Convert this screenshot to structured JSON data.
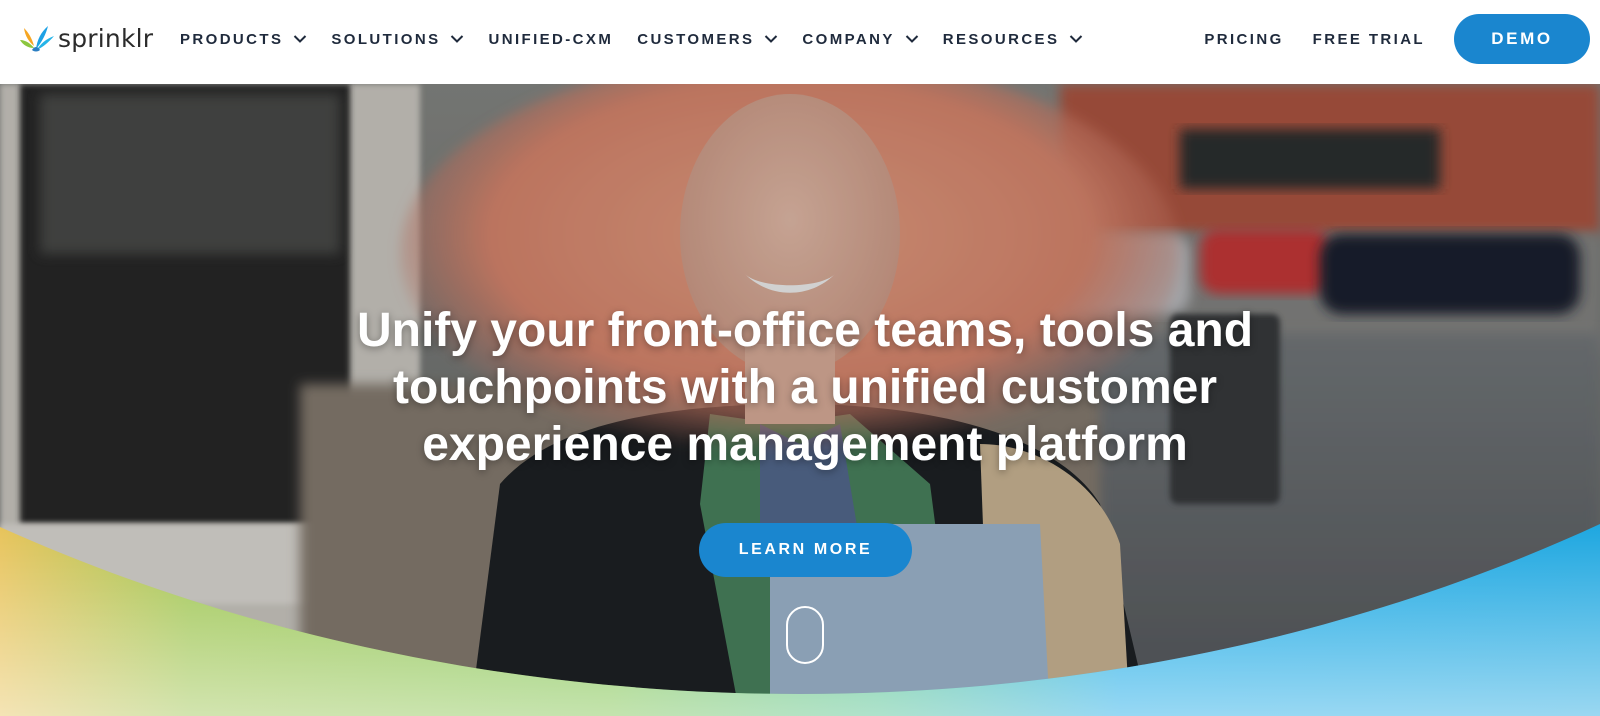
{
  "brand": {
    "name": "sprinklr",
    "logo_icon": "sprinklr-splash-icon"
  },
  "nav": {
    "items": [
      {
        "label": "PRODUCTS",
        "has_dropdown": true
      },
      {
        "label": "SOLUTIONS",
        "has_dropdown": true
      },
      {
        "label": "UNIFIED-CXM",
        "has_dropdown": false
      },
      {
        "label": "CUSTOMERS",
        "has_dropdown": true
      },
      {
        "label": "COMPANY",
        "has_dropdown": true
      },
      {
        "label": "RESOURCES",
        "has_dropdown": true
      }
    ],
    "pricing_label": "PRICING",
    "free_trial_label": "FREE TRIAL",
    "demo_label": "DEMO"
  },
  "hero": {
    "headline_lines": [
      "Unify your front-office teams, tools and",
      "touchpoints with a unified customer",
      "experience management platform"
    ],
    "cta_label": "LEARN MORE",
    "scroll_icon": "mouse-scroll-icon"
  },
  "colors": {
    "accent": "#1a86cf",
    "nav_text": "#1f2a3c",
    "wave_left": "#e7c35a",
    "wave_mid": "#7cc24a",
    "wave_right": "#19a9e6"
  }
}
